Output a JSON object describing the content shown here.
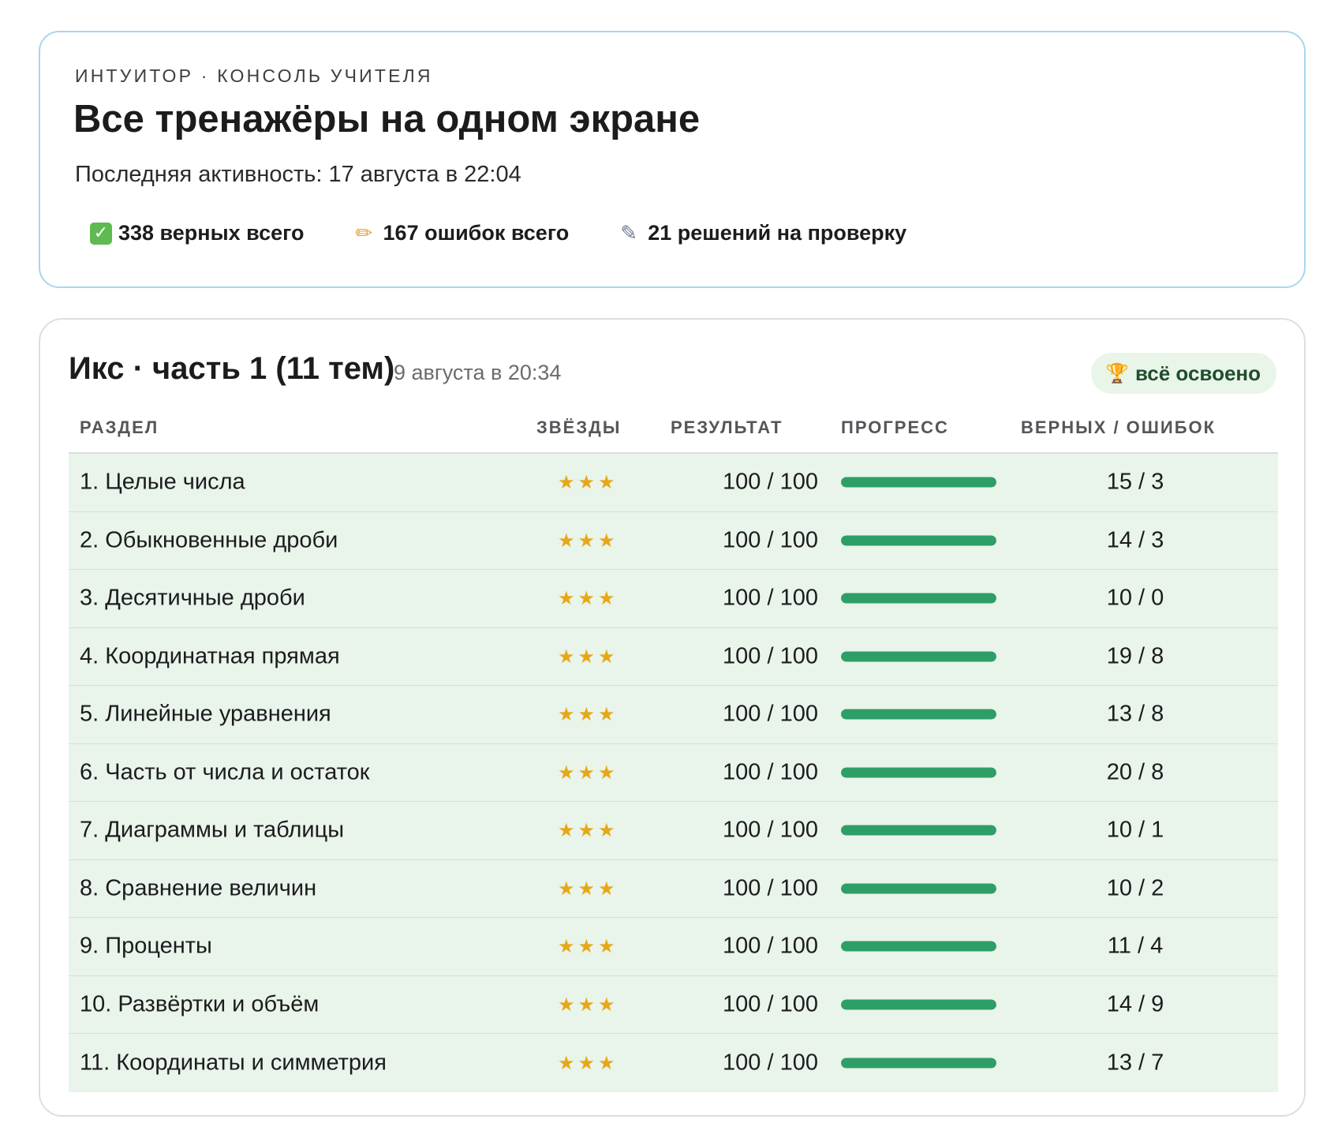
{
  "header": {
    "eyebrow": "ИНТУИТОР · КОНСОЛЬ УЧИТЕЛЯ",
    "title": "Все тренажёры на одном экране",
    "last_activity": "Последняя активность: 17 августа в 22:04",
    "stats": [
      {
        "icon": "check-icon",
        "label": "338 верных всего"
      },
      {
        "icon": "pencil-icon",
        "label": "167 ошибок всего"
      },
      {
        "icon": "memo-icon",
        "label": "21 решений на проверку"
      }
    ]
  },
  "course": {
    "title": "Икс · часть 1 (11 тем)",
    "date": "9 августа в 20:34",
    "badge": "всё освоено",
    "columns": {
      "section": "РАЗДЕЛ",
      "stars": "ЗВЁЗДЫ",
      "result": "РЕЗУЛЬТАТ",
      "progress": "ПРОГРЕСС",
      "score": "ВЕРНЫХ / ОШИБОК"
    },
    "rows": [
      {
        "section": "1. Целые числа",
        "stars": "★★★",
        "result": "100 / 100",
        "progress": 1.0,
        "score": "15 / 3"
      },
      {
        "section": "2. Обыкновенные дроби",
        "stars": "★★★",
        "result": "100 / 100",
        "progress": 1.0,
        "score": "14 / 3"
      },
      {
        "section": "3. Десятичные дроби",
        "stars": "★★★",
        "result": "100 / 100",
        "progress": 1.0,
        "score": "10 / 0"
      },
      {
        "section": "4. Координатная прямая",
        "stars": "★★★",
        "result": "100 / 100",
        "progress": 1.0,
        "score": "19 / 8"
      },
      {
        "section": "5. Линейные уравнения",
        "stars": "★★★",
        "result": "100 / 100",
        "progress": 1.0,
        "score": "13 / 8"
      },
      {
        "section": "6. Часть от числа и остаток",
        "stars": "★★★",
        "result": "100 / 100",
        "progress": 1.0,
        "score": "20 / 8"
      },
      {
        "section": "7. Диаграммы и таблицы",
        "stars": "★★★",
        "result": "100 / 100",
        "progress": 1.0,
        "score": "10 / 1"
      },
      {
        "section": "8. Сравнение величин",
        "stars": "★★★",
        "result": "100 / 100",
        "progress": 1.0,
        "score": "10 / 2"
      },
      {
        "section": "9. Проценты",
        "stars": "★★★",
        "result": "100 / 100",
        "progress": 1.0,
        "score": "11 / 4"
      },
      {
        "section": "10. Развёртки и объём",
        "stars": "★★★",
        "result": "100 / 100",
        "progress": 1.0,
        "score": "14 / 9"
      },
      {
        "section": "11. Координаты и симметрия",
        "stars": "★★★",
        "result": "100 / 100",
        "progress": 1.0,
        "score": "13 / 7"
      }
    ]
  },
  "colors": {
    "header_border": "#a9d6ee",
    "row_background": "#e9f4ea",
    "progress_fill": "#2e9e68",
    "stars": "#e6a817",
    "badge_background": "#eaf5ea",
    "badge_text": "#1f4e2b"
  }
}
